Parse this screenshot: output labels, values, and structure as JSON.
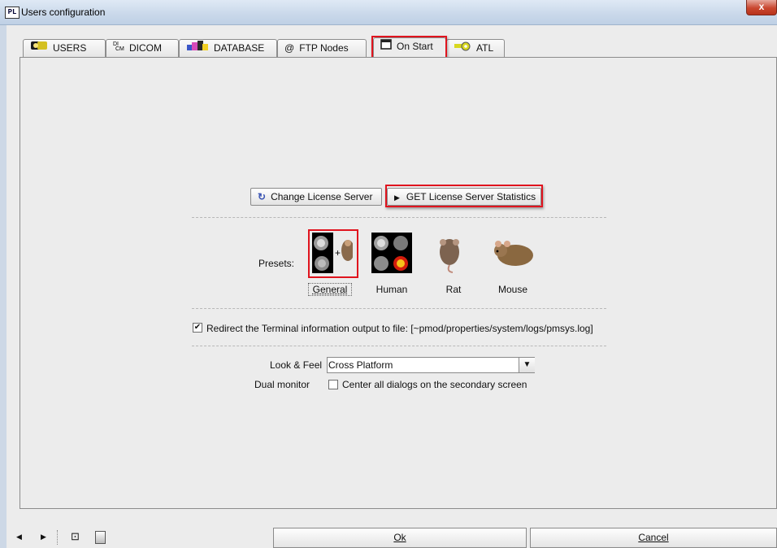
{
  "window": {
    "title": "Users configuration",
    "app_icon_text": "PL",
    "close_symbol": "x"
  },
  "tabs": [
    {
      "label": "USERS",
      "icon": "users-icon"
    },
    {
      "label": "DICOM",
      "icon": "dicom-icon"
    },
    {
      "label": "DATABASE",
      "icon": "database-icon"
    },
    {
      "label": "FTP Nodes",
      "icon": "at-icon",
      "glyph": "@"
    },
    {
      "label": "On Start",
      "icon": "on-start-icon",
      "active": true
    },
    {
      "label": "ATL",
      "icon": "key-icon"
    }
  ],
  "license": {
    "change_label": "Change License Server",
    "stats_label": "GET License Server Statistics"
  },
  "presets": {
    "label": "Presets:",
    "items": [
      {
        "label": "General",
        "selected": true,
        "icon": "general-preset-icon"
      },
      {
        "label": "Human",
        "icon": "human-preset-icon"
      },
      {
        "label": "Rat",
        "icon": "rat-preset-icon"
      },
      {
        "label": "Mouse",
        "icon": "mouse-preset-icon"
      }
    ]
  },
  "redirect": {
    "checked": true,
    "label": "Redirect the Terminal information output to file:  [~pmod/properties/system/logs/pmsys.log]"
  },
  "look_feel": {
    "label": "Look & Feel",
    "value": "Cross Platform"
  },
  "dual_monitor": {
    "label": "Dual monitor",
    "checkbox_label": "Center all dialogs on the secondary screen",
    "checked": false
  },
  "footer": {
    "ok": "Ok",
    "cancel": "Cancel"
  },
  "colors": {
    "highlight": "#e0141e",
    "panel": "#ececec"
  }
}
